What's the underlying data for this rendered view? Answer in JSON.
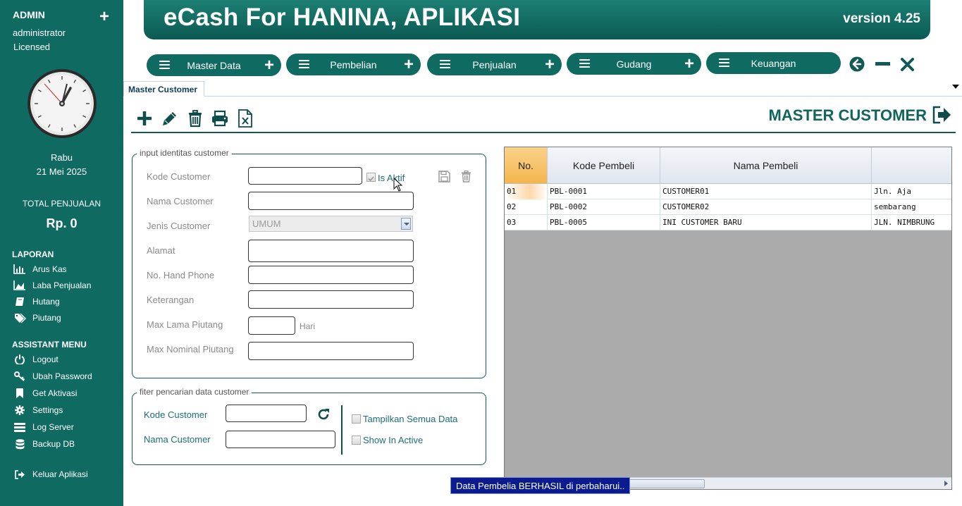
{
  "sidebar": {
    "role": "ADMIN",
    "user": "administrator",
    "license": "Licensed",
    "day": "Rabu",
    "date": "21 Mei 2025",
    "total_label": "TOTAL PENJUALAN",
    "total_value": "Rp. 0",
    "laporan_title": "LAPORAN",
    "laporan_items": [
      "Arus Kas",
      "Laba Penjualan",
      "Hutang",
      "Piutang"
    ],
    "assistant_title": "ASSISTANT MENU",
    "assistant_items": [
      "Logout",
      "Ubah Password",
      "Get Aktivasi",
      "Settings",
      "Log Server",
      "Backup DB"
    ],
    "exit": "Keluar Aplikasi"
  },
  "header": {
    "title": "eCash For HANINA, APLIKASI",
    "version": "version 4.25"
  },
  "menu": [
    "Master Data",
    "Pembelian",
    "Penjualan",
    "Gudang",
    "Keuangan"
  ],
  "tab": "Master Customer",
  "page_title": "MASTER CUSTOMER",
  "form": {
    "legend": "input identitas customer",
    "labels": {
      "kode": "Kode Customer",
      "nama": "Nama Customer",
      "jenis": "Jenis Customer",
      "alamat": "Alamat",
      "hp": "No. Hand Phone",
      "keterangan": "Keterangan",
      "max_lama": "Max Lama Piutang",
      "max_nominal": "Max Nominal Piutang"
    },
    "is_aktif": "Is Aktif",
    "jenis_value": "UMUM",
    "hari": "Hari"
  },
  "filter": {
    "legend": "fiter pencarian data customer",
    "kode": "Kode Customer",
    "nama": "Nama Customer",
    "show_all": "Tampilkan Semua Data",
    "show_inactive": "Show In Active"
  },
  "grid": {
    "columns": [
      "No.",
      "Kode Pembeli",
      "Nama Pembeli",
      ""
    ],
    "rows": [
      {
        "no": "01",
        "kode": "PBL-0001",
        "nama": "CUSTOMER01",
        "alamat": "Jln. Aja"
      },
      {
        "no": "02",
        "kode": "PBL-0002",
        "nama": "CUSTOMER02",
        "alamat": "sembarang"
      },
      {
        "no": "03",
        "kode": "PBL-0005",
        "nama": "INI CUSTOMER BARU",
        "alamat": "JLN. NIMBRUNG"
      }
    ]
  },
  "status_message": "Data Pembelia BERHASIL di perbaharui..",
  "colors": {
    "primary": "#0f6b62",
    "status_bg": "#0a1b8f"
  }
}
